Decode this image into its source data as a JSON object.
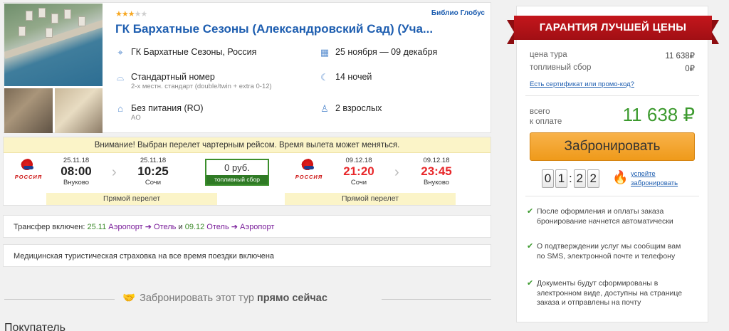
{
  "hotel": {
    "stars_on": "★★★",
    "stars_off": "★★",
    "operator": "Библио Глобус",
    "name": "ГК Бархатные Сезоны (Александровский Сад) (Уча...",
    "location": "ГК Бархатные Сезоны, Россия",
    "dates": "25 ноября — 09 декабря",
    "room": "Стандартный номер",
    "room_sub": "2-х местн. стандарт (double/twin + extra 0-12)",
    "nights": "14 ночей",
    "meal": "Без питания (RO)",
    "meal_sub": "AO",
    "guests": "2 взрослых",
    "icons": [
      "map-pin-icon",
      "calendar-icon",
      "bed-icon",
      "moon-icon",
      "meal-icon",
      "person-icon"
    ]
  },
  "flight": {
    "notice": "Внимание! Выбран перелет чартерным рейсом. Время вылета может меняться.",
    "airline_name": "РОССИЯ",
    "outbound": {
      "dep_date": "25.11.18",
      "dep_time": "08:00",
      "dep_city": "Внуково",
      "arr_date": "25.11.18",
      "arr_time": "10:25",
      "arr_city": "Сочи",
      "direct": "Прямой перелет"
    },
    "fuel": {
      "price": "0 руб.",
      "label": "топливный сбор"
    },
    "inbound": {
      "dep_date": "09.12.18",
      "dep_time": "21:20",
      "dep_city": "Сочи",
      "arr_date": "09.12.18",
      "arr_time": "23:45",
      "arr_city": "Внуково",
      "direct": "Прямой перелет"
    }
  },
  "transfer": {
    "prefix": "Трансфер включен:",
    "out_date": "25.11",
    "out_route": "Аэропорт ➔ Отель",
    "and": "и",
    "back_date": "09.12",
    "back_route": "Отель ➔ Аэропорт"
  },
  "insurance": "Медицинская туристическая страховка на все время поездки включена",
  "book_now": {
    "text": "Забронировать этот тур",
    "bold": "прямо сейчас"
  },
  "buyer_title": "Покупатель",
  "sidebar": {
    "ribbon": "ГАРАНТИЯ ЛУЧШЕЙ ЦЕНЫ",
    "price_label": "цена тура",
    "price_value": "11 638₽",
    "fuel_label": "топливный сбор",
    "fuel_value": "0₽",
    "cert_link": "Есть сертификат или промо-код?",
    "total_label_1": "всего",
    "total_label_2": "к оплате",
    "total_value": "11 638 ₽",
    "book_button": "Забронировать",
    "timer": [
      "0",
      "1",
      "2",
      "2"
    ],
    "hurry_1": "успейте",
    "hurry_2": "забронировать",
    "features": [
      "После оформления и оплаты заказа бронирование начнется автоматически",
      "О подтверждении услуг мы сообщим вам по SMS, электронной почте и телефону",
      "Документы будут сформированы в электронном виде, доступны на странице заказа и отправлены на почту"
    ]
  },
  "colors": {
    "brand_blue": "#1e5eb0",
    "accent_orange": "#f4a530",
    "price_green": "#3c9a2e",
    "ribbon_red": "#c4161c",
    "notice_yellow": "#fbf4c8"
  }
}
